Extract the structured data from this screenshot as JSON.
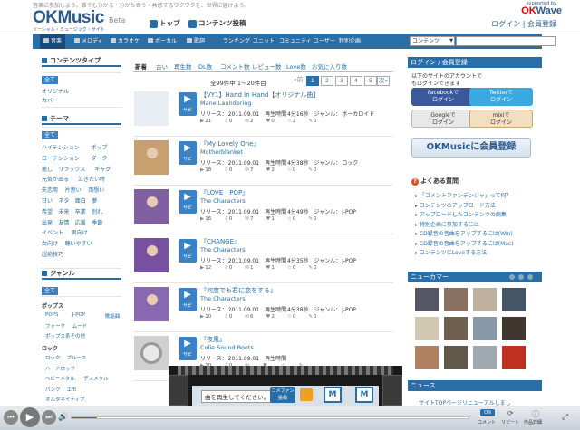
{
  "header": {
    "tagline": "音楽に参加しよう。誰でも分かる・分かち合う・共感するワクワクを、世界に届けよう。",
    "logo": "OKMusic",
    "logo_beta": "Beta",
    "logo_sub": "ソーシャル・ミュージック・サイト",
    "nav_top": "トップ",
    "nav_post": "コンテンツ投稿",
    "supported_by": "supported by",
    "okwave_a": "OK",
    "okwave_b": "Wave",
    "login": "ログイン",
    "separator": "|",
    "register": "会員登録"
  },
  "navbar": {
    "items": [
      "音楽",
      "メロディ",
      "カラオケ",
      "ボーカル",
      "歌詞",
      "ランキング",
      "ユニット",
      "コミュニティ",
      "ユーザー",
      "特別企画"
    ],
    "search_scope": "コンテンツ",
    "search_placeholder": ""
  },
  "sidebar": {
    "content_type": {
      "title": "コンテンツタイプ",
      "selected": "全て",
      "items": [
        "オリジナル",
        "カバー"
      ]
    },
    "theme": {
      "title": "テーマ",
      "selected": "全て",
      "rows": [
        [
          "ハイテンション",
          "ポップ"
        ],
        [
          "ローテンション",
          "ダーク"
        ],
        [
          "癒し",
          "リラックス",
          "ギャグ"
        ],
        [
          "元気が出る",
          "泣きたい時"
        ],
        [
          "失恋用",
          "片思い",
          "両想い"
        ],
        [
          "甘い",
          "ネタ",
          "面白",
          "夢"
        ],
        [
          "希望",
          "未来",
          "卒業",
          "別れ"
        ],
        [
          "出発",
          "友情",
          "応援",
          "季節"
        ],
        [
          "イベント",
          "男向け"
        ],
        [
          "女向け",
          "聴いやすい"
        ],
        [
          "超絶技巧"
        ]
      ]
    },
    "genre": {
      "title": "ジャンル",
      "selected": "全て",
      "pops_title": "ポップス",
      "pops_items": [
        [
          "POPS",
          "J-POP",
          "歌謡曲"
        ],
        [
          "フォーク",
          "ムード"
        ],
        [
          "ポップス系その他"
        ]
      ],
      "rock_title": "ロック",
      "rock_items": [
        [
          "ロック",
          "ブルース"
        ],
        [
          "ハードロック"
        ],
        [
          "ヘビーメタル",
          "デスメタル"
        ],
        [
          "パンク",
          "エモ"
        ],
        [
          "オルタネイティブ"
        ]
      ]
    }
  },
  "tabs": [
    "新着",
    "古い",
    "再生数",
    "DL数",
    "コメント数",
    "レビュー数",
    "Love数",
    "お気に入り数"
  ],
  "pagination": {
    "count": "全99件中 1〜20件目",
    "prev": "«前",
    "pages": [
      "1",
      "2",
      "3",
      "4",
      "5"
    ],
    "next": "次»"
  },
  "tracks": [
    {
      "title": "【VY1】Hand In Hand【オリジナル曲】",
      "artist": "Mane Laundering",
      "release_label": "リリース：",
      "release": "2011.09.01",
      "play_label": "再生時間",
      "duration": "4分16秒",
      "genre_label": "ジャンル：",
      "genre": "ボーカロイド",
      "plays": "21",
      "dl": "0",
      "comments": "2",
      "love": "0",
      "fav": "2",
      "reviews": "0"
    },
    {
      "title": "『My Lovely One』",
      "artist": "Motherblanket",
      "release_label": "リリース：",
      "release": "2011.09.01",
      "play_label": "再生時間",
      "duration": "4分38秒",
      "genre_label": "ジャンル：",
      "genre": "ロック",
      "plays": "18",
      "dl": "0",
      "comments": "7",
      "love": "2",
      "fav": "0",
      "reviews": "0"
    },
    {
      "title": "『LOVE　POP』",
      "artist": "The Characters",
      "release_label": "リリース：",
      "release": "2011.09.01",
      "play_label": "再生時間",
      "duration": "4分49秒",
      "genre_label": "ジャンル：",
      "genre": "J-POP",
      "plays": "16",
      "dl": "0",
      "comments": "7",
      "love": "1",
      "fav": "0",
      "reviews": "0"
    },
    {
      "title": "『CHANGE』",
      "artist": "The Characters",
      "release_label": "リリース：",
      "release": "2011.09.01",
      "play_label": "再生時間",
      "duration": "4分35秒",
      "genre_label": "ジャンル：",
      "genre": "J-POP",
      "plays": "12",
      "dl": "0",
      "comments": "1",
      "love": "1",
      "fav": "0",
      "reviews": "0"
    },
    {
      "title": "『何度でも君に恋をする』",
      "artist": "The Characters",
      "release_label": "リリース：",
      "release": "2011.09.01",
      "play_label": "再生時間",
      "duration": "4分38秒",
      "genre_label": "ジャンル：",
      "genre": "J-POP",
      "plays": "10",
      "dl": "0",
      "comments": "6",
      "love": "2",
      "fav": "0",
      "reviews": "0"
    },
    {
      "title": "『夜風』",
      "artist": "Colie Sound Roots",
      "release_label": "リリース：",
      "release": "2011.09.01",
      "play_label": "再生時間",
      "duration": "",
      "genre_label": "",
      "genre": "",
      "plays": "10",
      "dl": "0",
      "comments": "",
      "love": "",
      "fav": "",
      "reviews": ""
    }
  ],
  "right": {
    "login_head": "ログイン / 会員登録",
    "login_text1": "以下のサイトのアカウントで",
    "login_text2": "もログインできます",
    "facebook": "Facebookで",
    "twitter": "Twitterで",
    "google": "Googleで",
    "mixi": "mixiで",
    "login_word": "ログイン",
    "okreg": "OKMusicに会員登録",
    "faq_title": "よくある質問",
    "faq": [
      "「コメントファンデンジャ」って何？",
      "コンテンツのアップロード方法",
      "アップロードしたコンテンツの編集",
      "特別企画に参加するには",
      "CD録音の音曲をアップするには(Win)",
      "CD録音の音曲をアップするには(Mac)",
      "コンテンツにLoveする方法"
    ],
    "newcomer": "ニューカマー",
    "news": "ニュース",
    "news_item": "サイトTOPページリニューアルしまし"
  },
  "player": {
    "now_playing": "曲を再生してください。",
    "cm_btn": "コメファン 投稿",
    "on_label": "ON",
    "comment": "コメント",
    "repeat": "リピート",
    "detail": "作品詳細"
  }
}
